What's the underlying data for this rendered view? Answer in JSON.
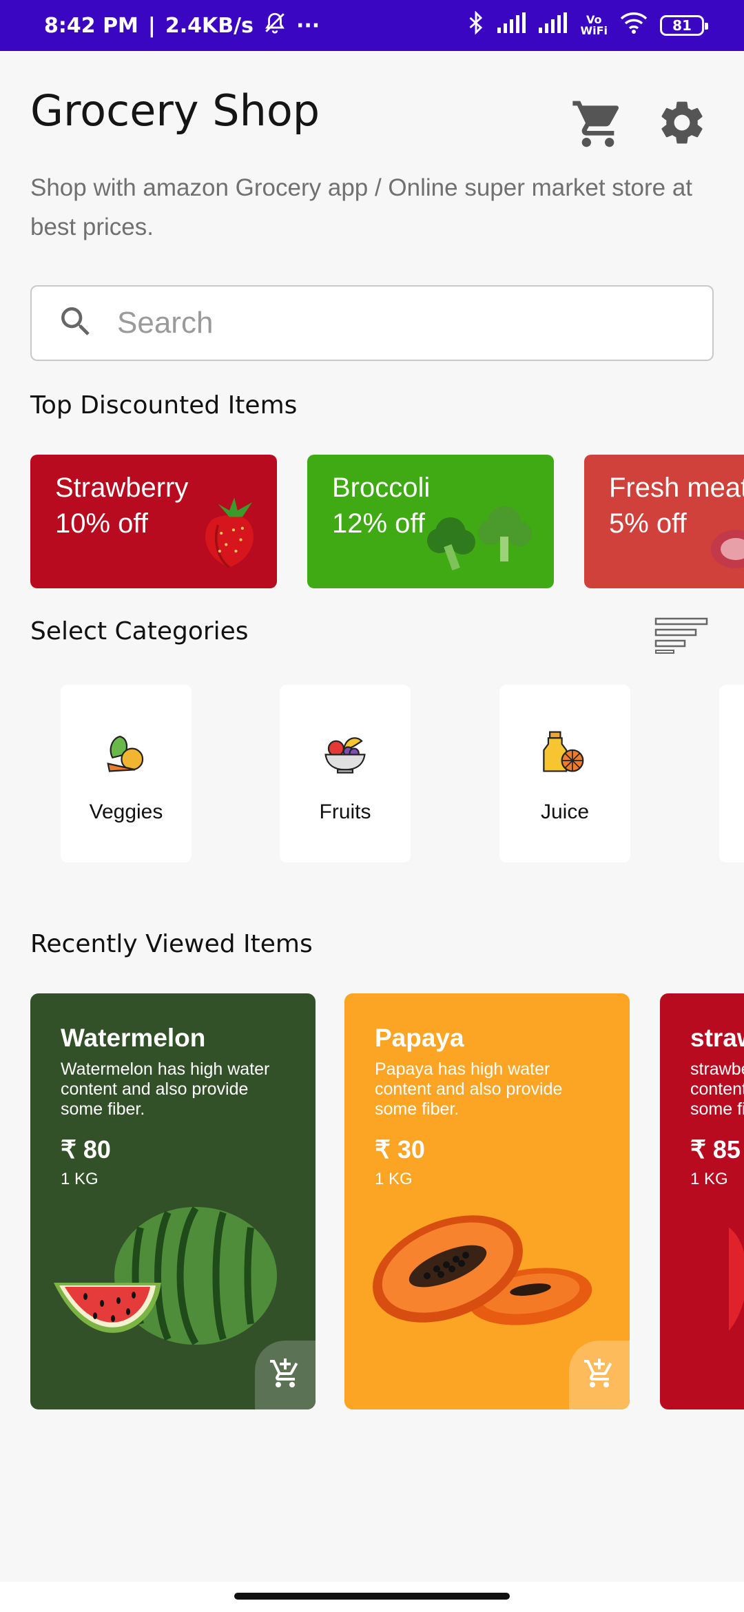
{
  "status_bar": {
    "time": "8:42 PM",
    "separator": "|",
    "speed": "2.4KB/s",
    "dots": "···",
    "vowifi_top": "Vo",
    "vowifi_bottom": "WiFi",
    "battery": "81",
    "background": "#3a06c2"
  },
  "header": {
    "title": "Grocery Shop",
    "subtitle": "Shop with amazon Grocery app / Online super market store at best prices."
  },
  "search": {
    "placeholder": "Search",
    "value": ""
  },
  "top_discounted": {
    "section_title": "Top Discounted Items",
    "items": [
      {
        "name": "Strawberry",
        "discount": "10% off",
        "color": "#b80b1f"
      },
      {
        "name": "Broccoli",
        "discount": "12% off",
        "color": "#3faa14"
      },
      {
        "name": "Fresh meat",
        "discount": "5% off",
        "color": "#d0413c"
      }
    ]
  },
  "categories": {
    "section_title": "Select Categories",
    "items": [
      {
        "label": "Veggies"
      },
      {
        "label": "Fruits"
      },
      {
        "label": "Juice"
      },
      {
        "label": ""
      }
    ]
  },
  "recently_viewed": {
    "section_title": "Recently Viewed Items",
    "items": [
      {
        "name": "Watermelon",
        "description": "Watermelon has high water content and also provide some fiber.",
        "price": "₹ 80",
        "unit": "1 KG",
        "color": "#335128"
      },
      {
        "name": "Papaya",
        "description": "Papaya has high water content and also provide some fiber.",
        "price": "₹ 30",
        "unit": "1 KG",
        "color": "#fca424"
      },
      {
        "name": "strawberry",
        "description": "strawberry has high water content and also provide some fiber.",
        "price": "₹ 85",
        "unit": "1 KG",
        "color": "#b80b1f"
      }
    ]
  }
}
